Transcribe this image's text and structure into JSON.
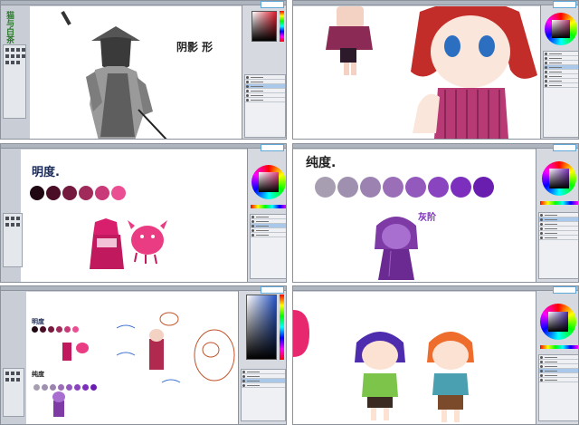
{
  "app": {
    "logo_text": "猫与白茶"
  },
  "panels": {
    "p1": {
      "title_note": "阴影  形"
    },
    "p2": {},
    "p3": {
      "note": "明度."
    },
    "p4": {
      "note": "纯度.",
      "sub_note": "灰阶"
    },
    "p5": {
      "note": "明度",
      "note2": "纯度"
    },
    "p6": {}
  },
  "swatches": {
    "brightness": [
      "#200812",
      "#4a0d26",
      "#731a3e",
      "#a02a5a",
      "#c93a78",
      "#ea4f93"
    ],
    "saturation": [
      "#a79fb1",
      "#9e90ae",
      "#9b82b1",
      "#9a6fb8",
      "#9459bd",
      "#8b44c0",
      "#7c2fbd",
      "#6a1eb0"
    ]
  },
  "colors": {
    "accent": "#2a87c7",
    "ui": "#c9ced6",
    "selected_layer": "#aac8ea"
  }
}
